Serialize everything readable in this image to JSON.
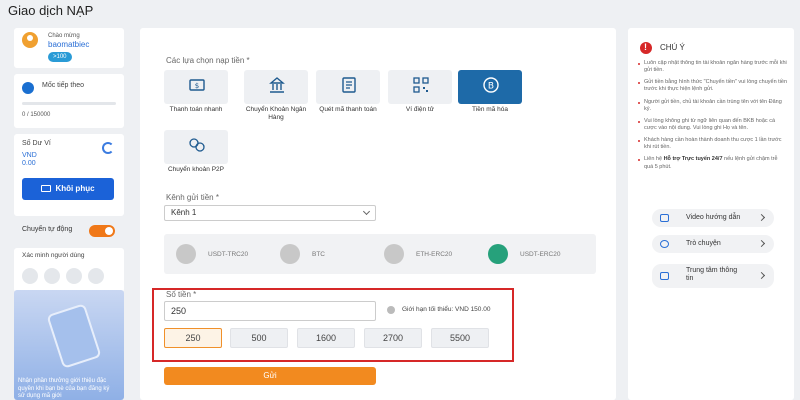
{
  "page_title": "Giao dịch NẠP",
  "user": {
    "greeting": "Chào mừng",
    "username": "baomatbiec",
    "vip_badge": ">100"
  },
  "level": {
    "label": "Mốc tiếp theo",
    "progress_text": "0 / 150000",
    "progress_fraction": 0
  },
  "balance": {
    "label": "Số Dư Ví",
    "currency": "VND",
    "value": "0.00",
    "restore_label": "Khôi phục"
  },
  "auto_transfer": {
    "label": "Chuyển tự động",
    "on": true
  },
  "verify": {
    "label": "Xác minh người dùng"
  },
  "promo": {
    "text": "Nhận phần thưởng giới thiệu đặc quyền khi bạn bè của bạn đăng ký sử dụng mã giới"
  },
  "deposit": {
    "options_label": "Các lựa chọn nạp tiền *",
    "methods": [
      {
        "label": "Thanh toán nhanh",
        "icon": "fast-pay-icon",
        "active": false
      },
      {
        "label": "Chuyển Khoản Ngân Hàng",
        "icon": "bank-transfer-icon",
        "active": false
      },
      {
        "label": "Quét mã thanh toán",
        "icon": "scan-pay-icon",
        "active": false
      },
      {
        "label": "Ví điện tử",
        "icon": "qr-wallet-icon",
        "active": false
      },
      {
        "label": "Tiền mã hóa",
        "icon": "crypto-icon",
        "active": true
      },
      {
        "label": "Chuyển khoản P2P",
        "icon": "p2p-icon",
        "active": false
      }
    ],
    "channel_label": "Kênh gửi tiền *",
    "channel_value": "Kênh 1",
    "coins": [
      {
        "label": "USDT-TRC20",
        "color": "#c8c8c8"
      },
      {
        "label": "BTC",
        "color": "#c8c8c8"
      },
      {
        "label": "ETH-ERC20",
        "color": "#c8c8c8"
      },
      {
        "label": "USDT-ERC20",
        "color": "#26a17b"
      }
    ],
    "amount_label": "Số tiền *",
    "amount_value": "250",
    "limit_text": "Giới hạn tối thiểu: VND 150.00",
    "quick_amounts": [
      "250",
      "500",
      "1600",
      "2700",
      "5500"
    ],
    "selected_amount": "250",
    "submit_label": "Gửi"
  },
  "notes": {
    "title": "CHÚ Ý",
    "items": [
      "Luôn cập nhật thông tin tài khoản ngân hàng trước mỗi khi gửi tiền.",
      "Gửi tiền bằng hình thức \"Chuyển tiền\" vui lòng chuyển tiền trước khi thực hiện lệnh gửi.",
      "Người gửi tiền, chủ tài khoản cần trùng tên với tên Đăng ký.",
      "Vui lòng không ghi từ ngữ liên quan đến BKB hoặc cá cược vào nội dung. Vui lòng ghi Họ và tên.",
      "Khách hàng cần hoàn thành doanh thu cược 1 lần trước khi rút tiền."
    ],
    "last_prefix": "Liên hệ ",
    "last_bold": "Hỗ trợ Trực tuyến 24/7",
    "last_suffix": " nếu lệnh gửi chậm trễ quá 5 phút."
  },
  "support": [
    {
      "label": "Video hướng dẫn",
      "icon": "video-icon"
    },
    {
      "label": "Trò chuyện",
      "icon": "chat-icon"
    },
    {
      "label": "Trung tâm thông tin",
      "icon": "info-center-icon"
    }
  ]
}
